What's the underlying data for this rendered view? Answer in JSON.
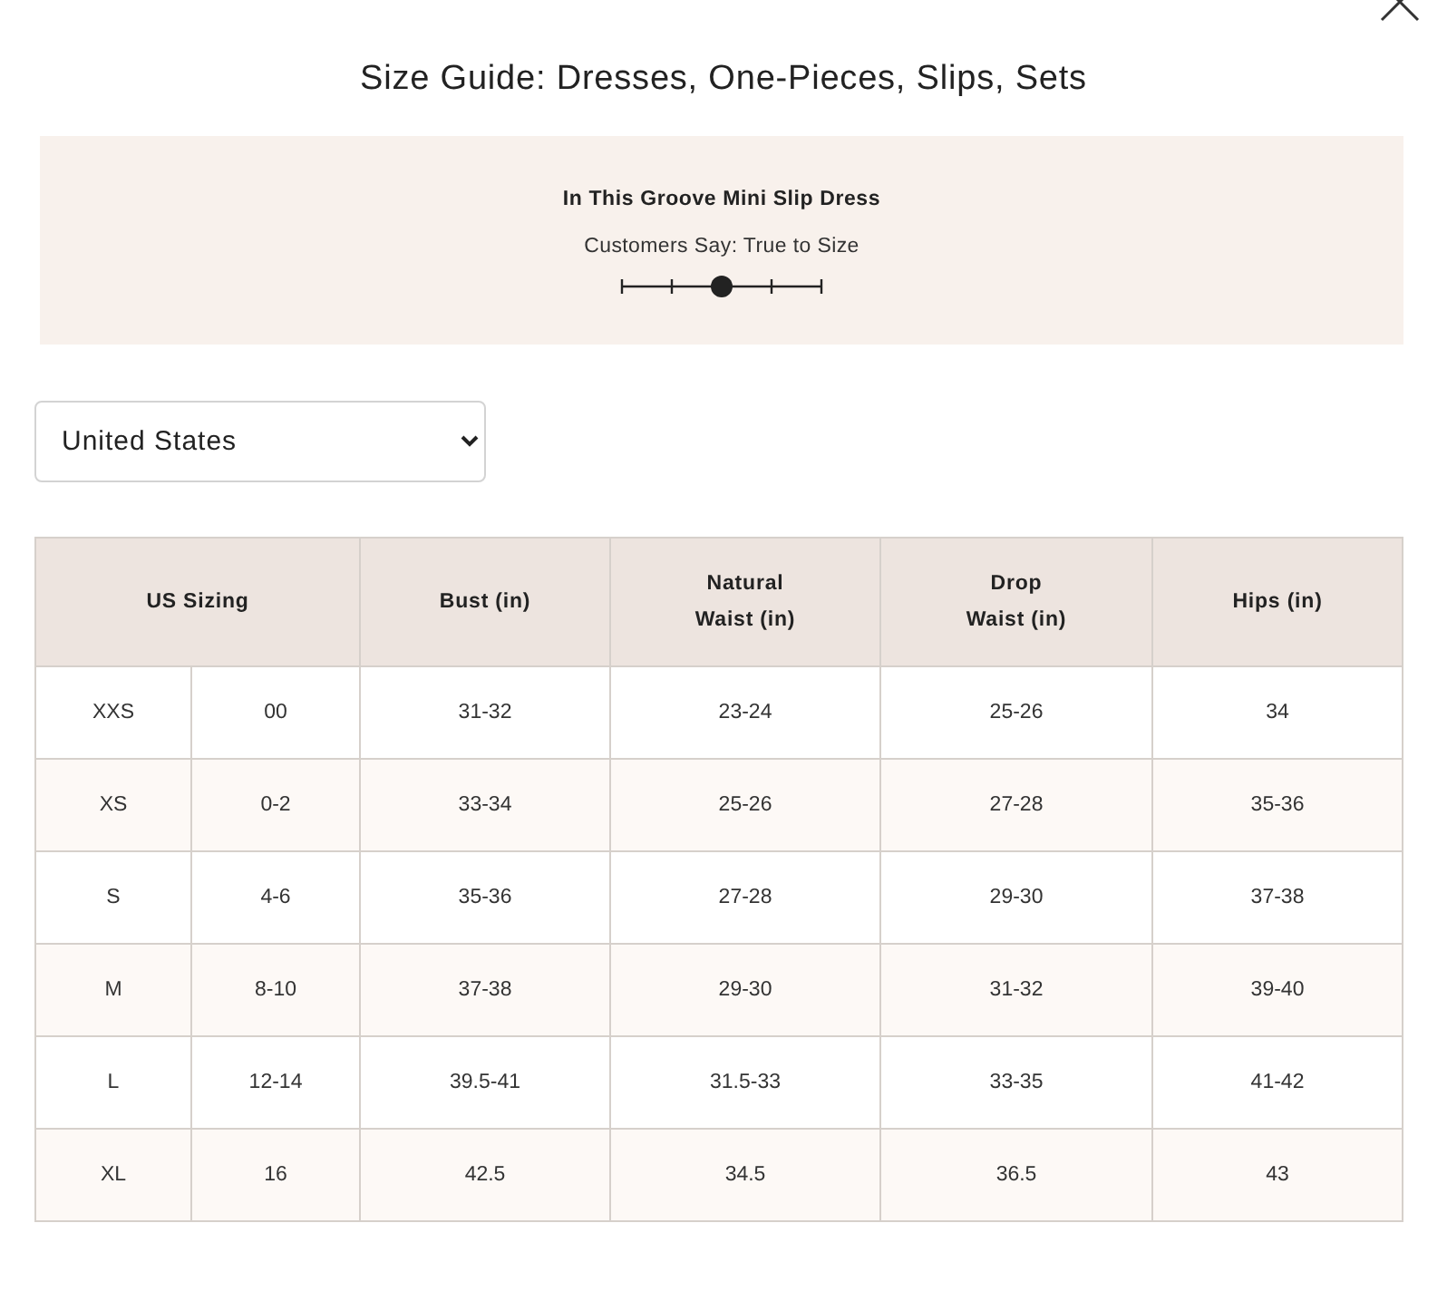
{
  "title": "Size Guide: Dresses, One-Pieces, Slips, Sets",
  "fit": {
    "product": "In This Groove Mini Slip Dress",
    "verdict": "Customers Say: True to Size",
    "level": 0.5
  },
  "country_select": {
    "value": "United States"
  },
  "table": {
    "columns": [
      {
        "label": "US Sizing",
        "colspan": 2
      },
      {
        "label": "Bust (in)"
      },
      {
        "label": "Natural Waist (in)"
      },
      {
        "label": "Drop Waist (in)"
      },
      {
        "label": "Hips (in)"
      }
    ],
    "rows": [
      [
        "XXS",
        "00",
        "31-32",
        "23-24",
        "25-26",
        "34"
      ],
      [
        "XS",
        "0-2",
        "33-34",
        "25-26",
        "27-28",
        "35-36"
      ],
      [
        "S",
        "4-6",
        "35-36",
        "27-28",
        "29-30",
        "37-38"
      ],
      [
        "M",
        "8-10",
        "37-38",
        "29-30",
        "31-32",
        "39-40"
      ],
      [
        "L",
        "12-14",
        "39.5-41",
        "31.5-33",
        "33-35",
        "41-42"
      ],
      [
        "XL",
        "16",
        "42.5",
        "34.5",
        "36.5",
        "43"
      ]
    ]
  }
}
